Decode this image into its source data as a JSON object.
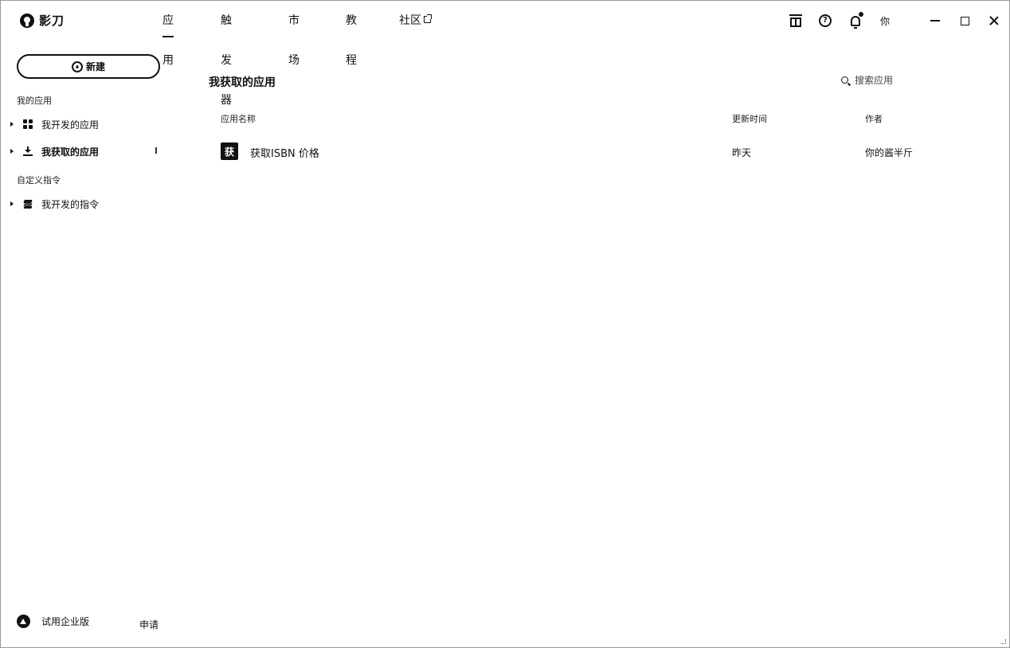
{
  "app": {
    "title": "影刀"
  },
  "nav": {
    "items": [
      {
        "label": "应用",
        "active": true
      },
      {
        "label": "触发器",
        "active": false
      },
      {
        "label": "市场",
        "active": false
      },
      {
        "label": "教程",
        "active": false
      },
      {
        "label": "社区",
        "active": false,
        "external": true
      }
    ]
  },
  "topbar": {
    "icons": [
      "gift-icon",
      "help-icon",
      "bell-icon"
    ],
    "help_glyph": "?",
    "notification_dot": true,
    "user_label": "你"
  },
  "sidebar": {
    "new_button_label": "新建",
    "sections": [
      {
        "title": "我的应用",
        "items": [
          {
            "label": "我开发的应用",
            "icon": "grid-icon"
          },
          {
            "label": "我获取的应用",
            "icon": "download-icon",
            "selected": true
          }
        ]
      },
      {
        "title": "自定义指令",
        "items": [
          {
            "label": "我开发的指令",
            "icon": "layers-icon"
          }
        ]
      }
    ],
    "footer": {
      "trial_label": "试用企业版",
      "apply_label": "申请"
    }
  },
  "main": {
    "title": "我获取的应用",
    "search_placeholder": "搜索应用",
    "columns": [
      "应用名称",
      "更新时间",
      "作者"
    ],
    "rows": [
      {
        "icon_char": "获",
        "name": "获取ISBN 价格",
        "updated": "昨天",
        "author": "你的酱半斤"
      }
    ]
  },
  "colors": {
    "text": "#111111",
    "background": "#ffffff",
    "border": "#9a9a9a"
  }
}
